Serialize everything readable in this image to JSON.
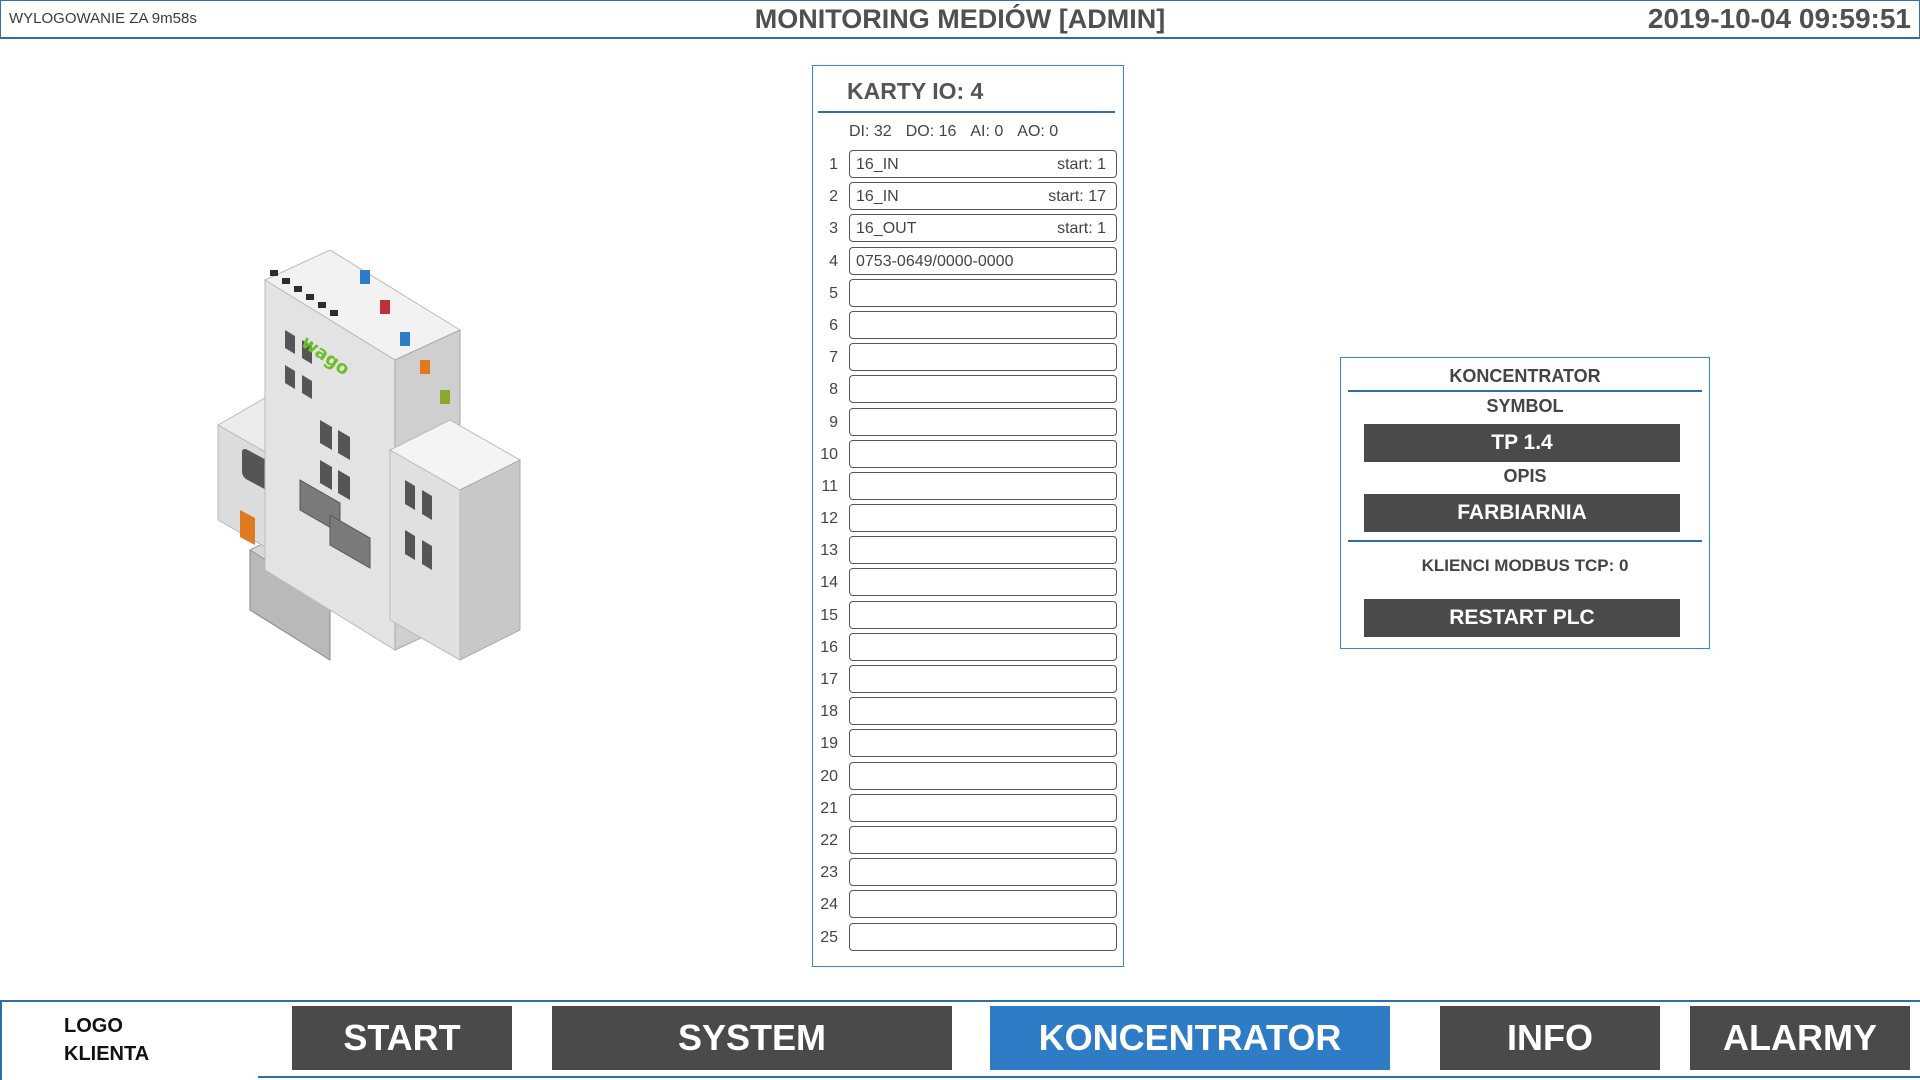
{
  "header": {
    "logout_timer": "WYLOGOWANIE ZA 9m58s",
    "title": "MONITORING MEDIÓW [ADMIN]",
    "datetime": "2019-10-04 09:59:51"
  },
  "io_panel": {
    "title": "KARTY IO: 4",
    "stats": {
      "di": "DI: 32",
      "do": "DO: 16",
      "ai": "AI: 0",
      "ao": "AO: 0"
    },
    "rows": [
      {
        "num": "1",
        "name": "16_IN",
        "start": "start: 1"
      },
      {
        "num": "2",
        "name": "16_IN",
        "start": "start: 17"
      },
      {
        "num": "3",
        "name": "16_OUT",
        "start": "start: 1"
      },
      {
        "num": "4",
        "name": "0753-0649/0000-0000",
        "start": ""
      },
      {
        "num": "5",
        "name": "",
        "start": ""
      },
      {
        "num": "6",
        "name": "",
        "start": ""
      },
      {
        "num": "7",
        "name": "",
        "start": ""
      },
      {
        "num": "8",
        "name": "",
        "start": ""
      },
      {
        "num": "9",
        "name": "",
        "start": ""
      },
      {
        "num": "10",
        "name": "",
        "start": ""
      },
      {
        "num": "11",
        "name": "",
        "start": ""
      },
      {
        "num": "12",
        "name": "",
        "start": ""
      },
      {
        "num": "13",
        "name": "",
        "start": ""
      },
      {
        "num": "14",
        "name": "",
        "start": ""
      },
      {
        "num": "15",
        "name": "",
        "start": ""
      },
      {
        "num": "16",
        "name": "",
        "start": ""
      },
      {
        "num": "17",
        "name": "",
        "start": ""
      },
      {
        "num": "18",
        "name": "",
        "start": ""
      },
      {
        "num": "19",
        "name": "",
        "start": ""
      },
      {
        "num": "20",
        "name": "",
        "start": ""
      },
      {
        "num": "21",
        "name": "",
        "start": ""
      },
      {
        "num": "22",
        "name": "",
        "start": ""
      },
      {
        "num": "23",
        "name": "",
        "start": ""
      },
      {
        "num": "24",
        "name": "",
        "start": ""
      },
      {
        "num": "25",
        "name": "",
        "start": ""
      }
    ]
  },
  "koncentrator": {
    "title": "KONCENTRATOR",
    "symbol_label": "SYMBOL",
    "symbol_value": "TP 1.4",
    "opis_label": "OPIS",
    "opis_value": "FARBIARNIA",
    "modbus_clients": "KLIENCI MODBUS TCP: 0",
    "restart_label": "RESTART PLC"
  },
  "device_image": {
    "icon": "plc-controller-image",
    "brand_text": "wago",
    "accent_color": "#6cbf2a"
  },
  "footer": {
    "logo_line1": "LOGO",
    "logo_line2": "KLIENTA",
    "nav": [
      {
        "label": "START",
        "active": false
      },
      {
        "label": "SYSTEM",
        "active": false
      },
      {
        "label": "KONCENTRATOR",
        "active": true
      },
      {
        "label": "INFO",
        "active": false
      },
      {
        "label": "ALARMY",
        "active": false
      }
    ]
  },
  "colors": {
    "accent_blue": "#2f7cc6",
    "border_blue": "#2f6fa8",
    "button_dark": "#4a4a4a"
  }
}
